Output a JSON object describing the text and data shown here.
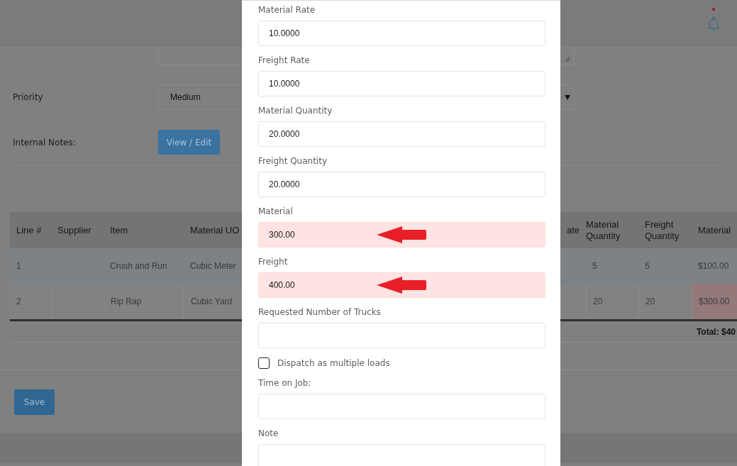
{
  "header": {
    "unread_notifications": true
  },
  "priority": {
    "label": "Priority",
    "value": "Medium"
  },
  "internal_notes": {
    "label": "Internal Notes:",
    "button": "View / Edit"
  },
  "line_items": {
    "columns": [
      "Line #",
      "Supplier",
      "Item",
      "Material UO",
      "ate",
      "Material Quantity",
      "Freight Quantity",
      "Material"
    ],
    "rows": [
      {
        "line": "1",
        "item": "Crush and Run",
        "material_uom": "Cubic Meter",
        "material_quantity": "5",
        "freight_quantity": "5",
        "material": "$100.00",
        "material_highlighted": false
      },
      {
        "line": "2",
        "item": "Rip Rap",
        "material_uom": "Cubic Yard",
        "material_quantity": "20",
        "freight_quantity": "20",
        "material": "$300.00",
        "material_highlighted": true
      }
    ],
    "total": "Total: $40"
  },
  "save_button": "Save",
  "modal": {
    "fields": [
      {
        "kind": "input",
        "label": "Material Rate",
        "value": "10.0000",
        "highlighted": false,
        "annotated": false
      },
      {
        "kind": "input",
        "label": "Freight Rate",
        "value": "10.0000",
        "highlighted": false,
        "annotated": false
      },
      {
        "kind": "input",
        "label": "Material Quantity",
        "value": "20.0000",
        "highlighted": false,
        "annotated": false
      },
      {
        "kind": "input",
        "label": "Freight Quantity",
        "value": "20.0000",
        "highlighted": false,
        "annotated": false
      },
      {
        "kind": "input",
        "label": "Material",
        "value": "300.00",
        "highlighted": true,
        "annotated": true
      },
      {
        "kind": "input",
        "label": "Freight",
        "value": "400.00",
        "highlighted": true,
        "annotated": true
      },
      {
        "kind": "input",
        "label": "Requested Number of Trucks",
        "highlighted": false,
        "annotated": false
      },
      {
        "kind": "checkbox",
        "label": "Dispatch as multiple loads",
        "checked": false
      },
      {
        "kind": "input",
        "label": "Time on Job:",
        "highlighted": false,
        "annotated": false
      },
      {
        "kind": "input",
        "label": "Note",
        "highlighted": false,
        "annotated": false
      }
    ]
  }
}
